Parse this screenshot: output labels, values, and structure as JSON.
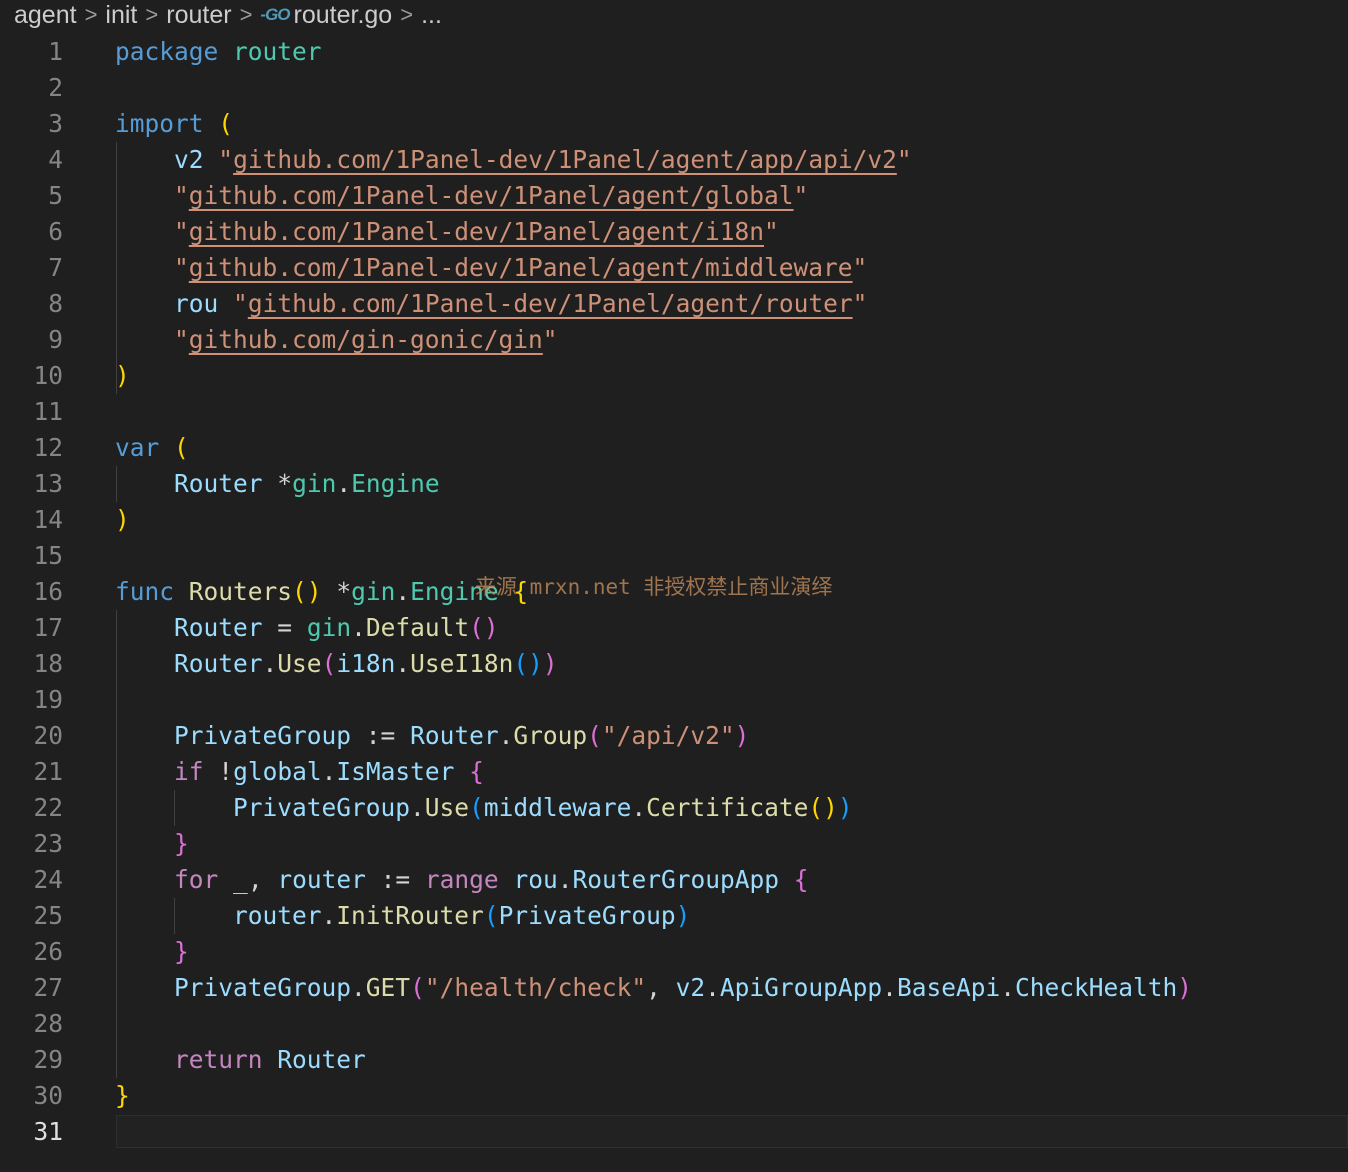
{
  "breadcrumb": {
    "items": [
      "agent",
      "init",
      "router"
    ],
    "file_icon": "-GO",
    "file_name": "router.go",
    "ellipsis": "..."
  },
  "editor": {
    "active_line": 31,
    "lines": [
      {
        "number": "1",
        "code": "package router"
      },
      {
        "number": "2",
        "code": ""
      },
      {
        "number": "3",
        "code": "import ("
      },
      {
        "number": "4",
        "code": "    v2 \"github.com/1Panel-dev/1Panel/agent/app/api/v2\""
      },
      {
        "number": "5",
        "code": "    \"github.com/1Panel-dev/1Panel/agent/global\""
      },
      {
        "number": "6",
        "code": "    \"github.com/1Panel-dev/1Panel/agent/i18n\""
      },
      {
        "number": "7",
        "code": "    \"github.com/1Panel-dev/1Panel/agent/middleware\""
      },
      {
        "number": "8",
        "code": "    rou \"github.com/1Panel-dev/1Panel/agent/router\""
      },
      {
        "number": "9",
        "code": "    \"github.com/gin-gonic/gin\""
      },
      {
        "number": "10",
        "code": ")"
      },
      {
        "number": "11",
        "code": ""
      },
      {
        "number": "12",
        "code": "var ("
      },
      {
        "number": "13",
        "code": "    Router *gin.Engine"
      },
      {
        "number": "14",
        "code": ")"
      },
      {
        "number": "15",
        "code": ""
      },
      {
        "number": "16",
        "code": "func Routers() *gin.Engine {"
      },
      {
        "number": "17",
        "code": "    Router = gin.Default()"
      },
      {
        "number": "18",
        "code": "    Router.Use(i18n.UseI18n())"
      },
      {
        "number": "19",
        "code": ""
      },
      {
        "number": "20",
        "code": "    PrivateGroup := Router.Group(\"/api/v2\")"
      },
      {
        "number": "21",
        "code": "    if !global.IsMaster {"
      },
      {
        "number": "22",
        "code": "        PrivateGroup.Use(middleware.Certificate())"
      },
      {
        "number": "23",
        "code": "    }"
      },
      {
        "number": "24",
        "code": "    for _, router := range rou.RouterGroupApp {"
      },
      {
        "number": "25",
        "code": "        router.InitRouter(PrivateGroup)"
      },
      {
        "number": "26",
        "code": "    }"
      },
      {
        "number": "27",
        "code": "    PrivateGroup.GET(\"/health/check\", v2.ApiGroupApp.BaseApi.CheckHealth)"
      },
      {
        "number": "28",
        "code": ""
      },
      {
        "number": "29",
        "code": "    return Router"
      },
      {
        "number": "30",
        "code": "}"
      },
      {
        "number": "31",
        "code": ""
      }
    ]
  },
  "watermark": "来源 mrxn.net 非授权禁止商业演绎",
  "colors": {
    "background": "#1f1f1f",
    "keyword": "#569cd6",
    "control": "#c586c0",
    "type": "#4ec9b0",
    "variable": "#9cdcfe",
    "function": "#dcdcaa",
    "string": "#ce9178",
    "bracket1": "#ffd700",
    "bracket2": "#da70d6",
    "bracket3": "#179fff"
  }
}
